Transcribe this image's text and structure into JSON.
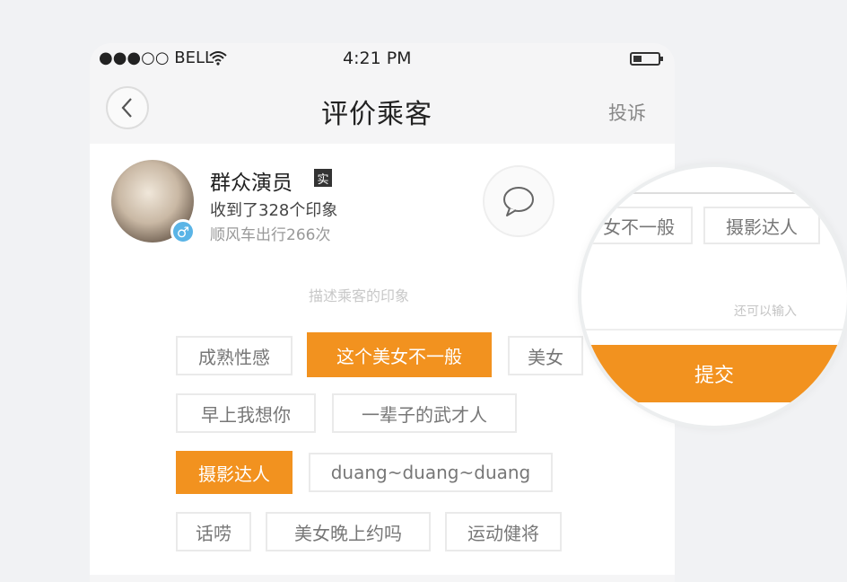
{
  "status_bar": {
    "signal": "●●●○○ BELL",
    "time": "4:21 PM"
  },
  "nav": {
    "title": "评价乘客",
    "complain": "投诉"
  },
  "user": {
    "name": "群众演员",
    "verified": "实",
    "impressions": "收到了328个印象",
    "trips": "顺风车出行266次",
    "gender_symbol": "♂"
  },
  "hint": "描述乘客的印象",
  "tags": [
    {
      "label": "成熟性感",
      "selected": false
    },
    {
      "label": "这个美女不一般",
      "selected": true
    },
    {
      "label": "美女",
      "selected": false
    },
    {
      "label": "早上我想你",
      "selected": false
    },
    {
      "label": "一辈子的武才人",
      "selected": false
    },
    {
      "label": "摄影达人",
      "selected": true
    },
    {
      "label": "duang~duang~duang",
      "selected": false
    },
    {
      "label": "话唠",
      "selected": false
    },
    {
      "label": "美女晚上约吗",
      "selected": false
    },
    {
      "label": "运动健将",
      "selected": false
    }
  ],
  "magnifier": {
    "tags": [
      "女不一般",
      "摄影达人"
    ],
    "counter": "还可以输入",
    "submit": "提交"
  },
  "colors": {
    "accent": "#f2921f",
    "gender_badge": "#5ab4e6"
  },
  "icons": {
    "back": "chevron-left-icon",
    "message": "chat-bubble-icon",
    "wifi": "wifi-icon",
    "battery": "battery-icon"
  }
}
